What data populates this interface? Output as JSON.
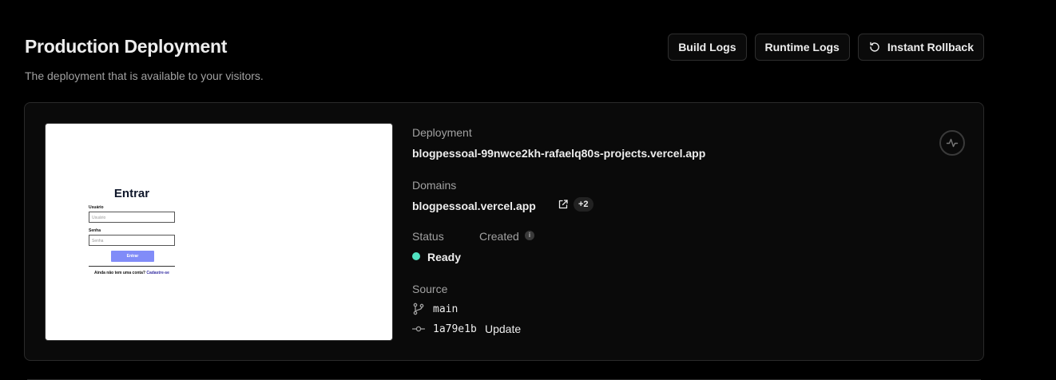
{
  "header": {
    "title": "Production Deployment",
    "subtitle": "The deployment that is available to your visitors."
  },
  "actions": {
    "build_logs": "Build Logs",
    "runtime_logs": "Runtime Logs",
    "instant_rollback": "Instant Rollback"
  },
  "preview": {
    "title": "Entrar",
    "user_label": "Usuário",
    "user_placeholder": "Usuário",
    "password_label": "Senha",
    "password_placeholder": "Senha",
    "submit": "Entrar",
    "footer_text": "Ainda não tem uma conta?",
    "footer_link": "Cadastre-se"
  },
  "deployment": {
    "label": "Deployment",
    "url": "blogpessoal-99nwce2kh-rafaelq80s-projects.vercel.app"
  },
  "domains": {
    "label": "Domains",
    "primary": "blogpessoal.vercel.app",
    "more": "+2"
  },
  "status": {
    "label": "Status",
    "value": "Ready",
    "color": "#50e3c2"
  },
  "created": {
    "label": "Created",
    "info_icon": "info-icon"
  },
  "source": {
    "label": "Source",
    "branch": "main",
    "commit_hash": "1a79e1b",
    "commit_message": "Update"
  }
}
